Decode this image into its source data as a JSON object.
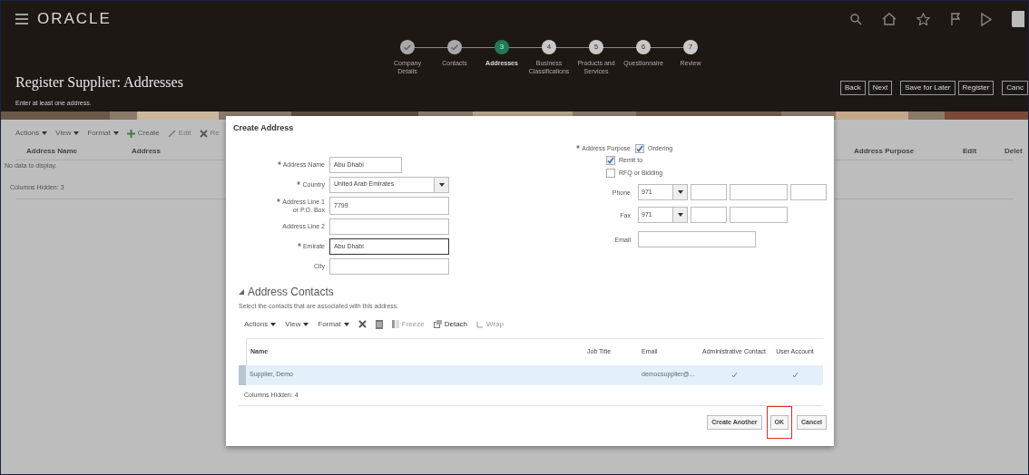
{
  "header": {
    "logo": "ORACLE",
    "steps": [
      {
        "label": "Company Details",
        "done": true,
        "current": false
      },
      {
        "label": "Contacts",
        "done": true,
        "current": false
      },
      {
        "label": "Addresses",
        "done": false,
        "current": true,
        "number": "3"
      },
      {
        "label": "Business Classifications",
        "done": false,
        "current": false,
        "number": "4"
      },
      {
        "label": "Products and Services",
        "done": false,
        "current": false,
        "number": "5"
      },
      {
        "label": "Questionnaire",
        "done": false,
        "current": false,
        "number": "6"
      },
      {
        "label": "Review",
        "done": false,
        "current": false,
        "number": "7"
      }
    ],
    "title": "Register Supplier: Addresses",
    "subtitle": "Enter at least one address.",
    "buttons": [
      "Back",
      "Next",
      "Save for Later",
      "Register",
      "Canc"
    ]
  },
  "addresses_table": {
    "toolbar": [
      {
        "label": "Actions",
        "kind": "menu",
        "disabled": false
      },
      {
        "label": "View",
        "kind": "menu",
        "disabled": false
      },
      {
        "label": "Format",
        "kind": "menu",
        "disabled": false
      },
      {
        "label": "Create",
        "kind": "create",
        "disabled": false
      },
      {
        "label": "Edit",
        "kind": "edit",
        "disabled": true
      },
      {
        "label": "Re",
        "kind": "remove",
        "disabled": true
      }
    ],
    "columns_left": [
      "Address Name",
      "Address"
    ],
    "columns_right": [
      "Address Purpose",
      "Edit",
      "Delet"
    ],
    "empty_text": "No data to display.",
    "columns_hidden": "Columns Hidden: 3"
  },
  "dialog": {
    "title": "Create Address",
    "fields": [
      {
        "label": "Address Name",
        "required": true,
        "kind": "short",
        "value": "Abu Dhabi",
        "focused": false
      },
      {
        "label": "Country",
        "required": true,
        "kind": "select",
        "value": "United Arab Emirates",
        "focused": false
      },
      {
        "label": "Address Line 1 or P.O. Box",
        "required": true,
        "kind": "text",
        "value": "7799",
        "focused": false
      },
      {
        "label": "Address Line 2",
        "required": false,
        "kind": "text",
        "focused": false
      },
      {
        "label": "Emirate",
        "required": true,
        "kind": "text",
        "value": "Abu Dhabi",
        "focused": true
      },
      {
        "label": "City",
        "required": false,
        "kind": "text",
        "focused": false
      }
    ],
    "purpose": {
      "label": "Address Purpose",
      "required": true,
      "options": [
        {
          "label": "Ordering",
          "checked": true
        },
        {
          "label": "Remit to",
          "checked": true
        },
        {
          "label": "RFQ or Bidding",
          "checked": false
        }
      ]
    },
    "phone": {
      "label": "Phone",
      "code": "971"
    },
    "fax": {
      "label": "Fax",
      "code": "971"
    },
    "email": {
      "label": "Email"
    },
    "contacts": {
      "title": "Address Contacts",
      "expanded": true,
      "description": "Select the contacts that are associated with this address.",
      "toolbar": [
        {
          "label": "Actions",
          "kind": "menu",
          "disabled": false
        },
        {
          "label": "View",
          "kind": "menu",
          "disabled": false
        },
        {
          "label": "Format",
          "kind": "menu",
          "disabled": false
        },
        {
          "kind": "delete",
          "disabled": false
        },
        {
          "kind": "export",
          "disabled": false
        },
        {
          "label": "Freeze",
          "kind": "freeze",
          "disabled": true
        },
        {
          "label": "Detach",
          "kind": "detach",
          "disabled": false
        },
        {
          "label": "Wrap",
          "kind": "wrap",
          "disabled": true
        }
      ],
      "columns": [
        "Name",
        "Job Title",
        "Email",
        "Administrative Contact",
        "User Account"
      ],
      "rows": [
        {
          "name": "Supplier, Demo",
          "email": "democsupplier@...",
          "administrative_contact": true,
          "user_account": true,
          "selected": true
        }
      ],
      "columns_hidden": "Columns Hidden: 4"
    },
    "buttons": [
      {
        "label": "Create Another",
        "highlighted": false
      },
      {
        "label": "OK",
        "highlighted": true
      },
      {
        "label": "Cancel",
        "highlighted": false
      }
    ]
  }
}
